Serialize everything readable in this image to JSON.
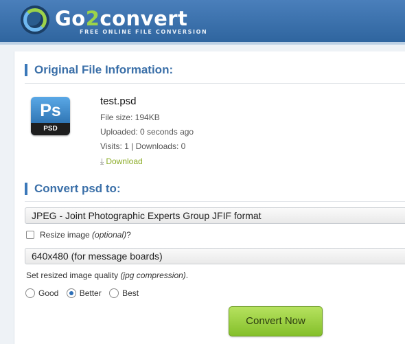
{
  "header": {
    "logo_prefix": "Go",
    "logo_two": "2",
    "logo_suffix": "convert",
    "tagline": "FREE ONLINE FILE CONVERSION"
  },
  "original": {
    "title": "Original File Information:",
    "icon_label": "Ps",
    "icon_band": "PSD",
    "filename": "test.psd",
    "filesize": "File size: 194KB",
    "uploaded": "Uploaded: 0 seconds ago",
    "visits": "Visits: 1 | Downloads: 0",
    "download": "Download"
  },
  "convert": {
    "title": "Convert psd to:",
    "format_selected": "JPEG - Joint Photographic Experts Group JFIF format",
    "resize_label": "Resize image",
    "resize_optional": "(optional)",
    "resize_q": "?",
    "size_selected": "640x480 (for message boards)",
    "quality_label": "Set resized image quality",
    "quality_note": "(jpg compression)",
    "quality_period": ".",
    "quality_options": [
      "Good",
      "Better",
      "Best"
    ],
    "quality_selected": "Better",
    "button_label": "Convert Now"
  }
}
